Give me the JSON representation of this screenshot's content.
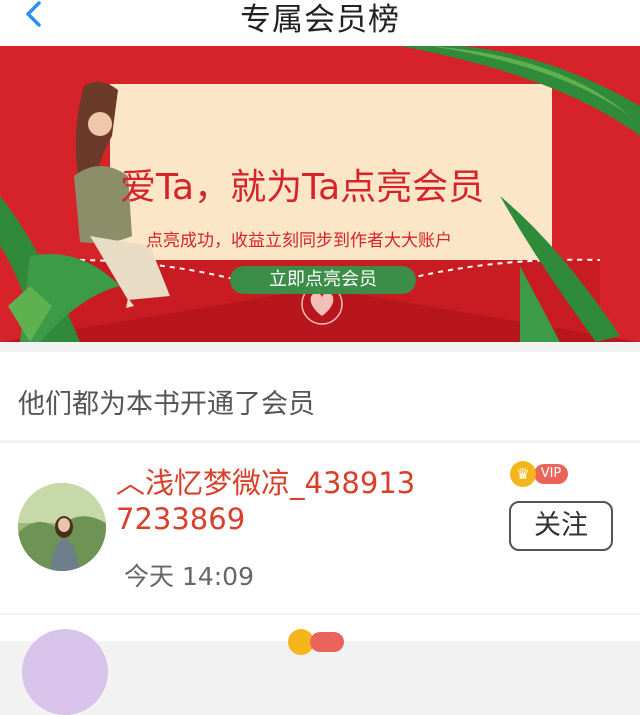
{
  "header": {
    "title": "专属会员榜",
    "back_icon": "chevron-left-icon"
  },
  "banner": {
    "headline": "爱Ta，就为Ta点亮会员",
    "subtitle": "点亮成功，收益立刻同步到作者大大账户",
    "cta_label": "立即点亮会员",
    "colors": {
      "red": "#d6232a",
      "cream": "#fbe7c8",
      "green": "#3c8d47"
    }
  },
  "section": {
    "title": "他们都为本书开通了会员"
  },
  "members": [
    {
      "name": "︿浅忆梦微凉_4389137233869",
      "time": "今天 14:09",
      "vip_label": "VIP",
      "follow_label": "关注"
    }
  ],
  "colors": {
    "name_red": "#d8402a",
    "vip_red": "#e9655a",
    "crown_gold": "#f5b51d",
    "back_blue": "#2f8ef4"
  }
}
